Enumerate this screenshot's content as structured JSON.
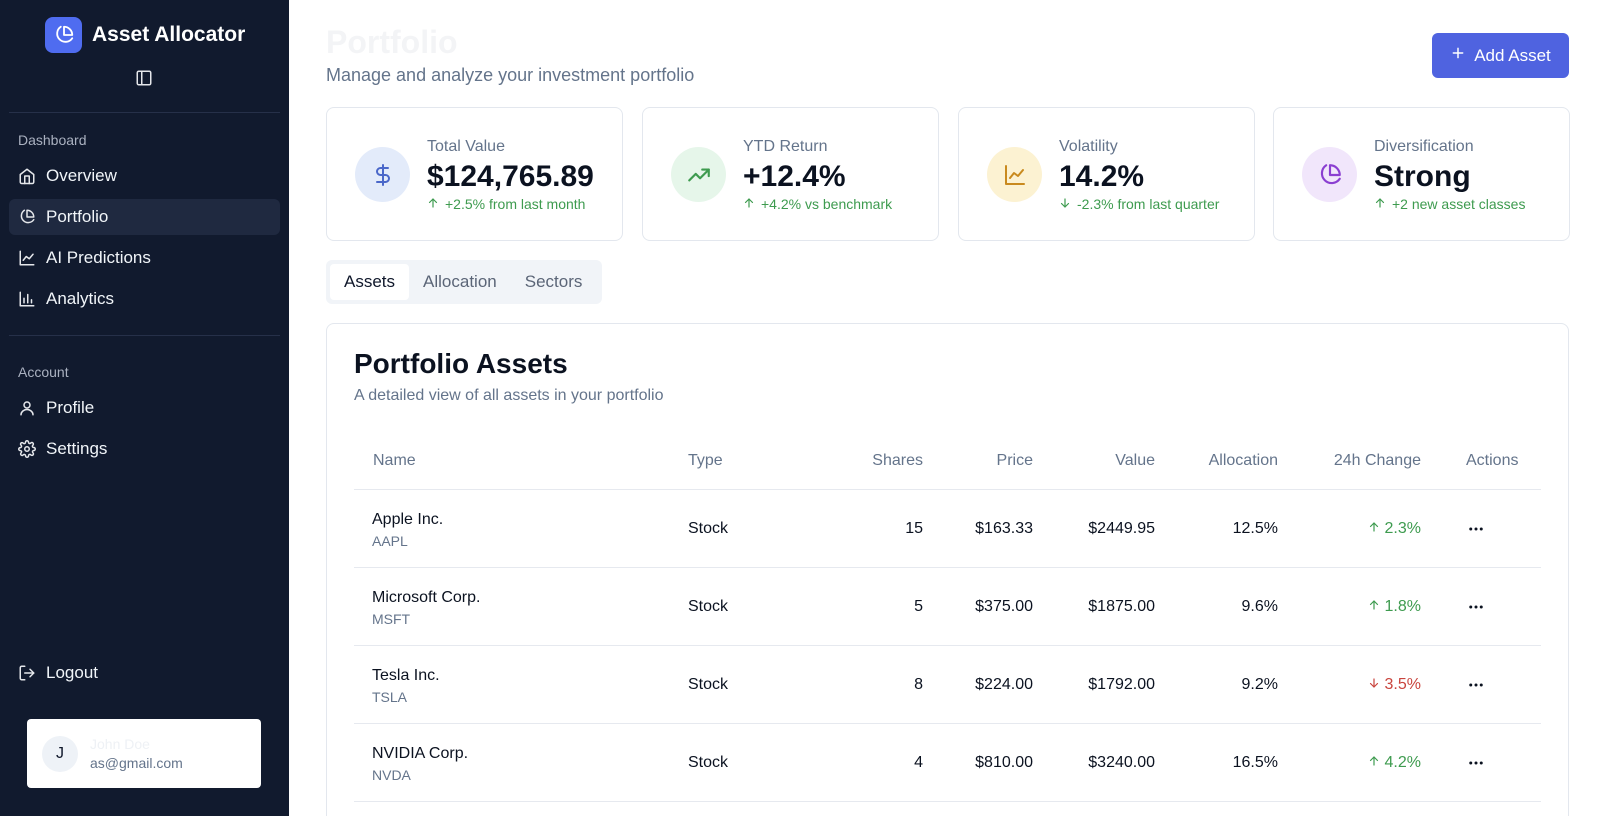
{
  "app": {
    "name": "Asset Allocator"
  },
  "sidebar": {
    "sections": [
      {
        "label": "Dashboard"
      },
      {
        "label": "Account"
      }
    ],
    "items": [
      {
        "label": "Overview",
        "icon": "home-icon"
      },
      {
        "label": "Portfolio",
        "icon": "pie-chart-icon",
        "active": true
      },
      {
        "label": "AI Predictions",
        "icon": "line-chart-icon"
      },
      {
        "label": "Analytics",
        "icon": "bar-chart-icon"
      },
      {
        "label": "Profile",
        "icon": "user-icon"
      },
      {
        "label": "Settings",
        "icon": "gear-icon"
      }
    ],
    "logout": {
      "label": "Logout",
      "icon": "logout-icon"
    },
    "user": {
      "initial": "J",
      "name": "John Doe",
      "email": "as@gmail.com"
    }
  },
  "header": {
    "title": "Portfolio",
    "subtitle": "Manage and analyze your investment portfolio",
    "add_button": "Add Asset"
  },
  "stats": [
    {
      "label": "Total Value",
      "value": "$124,765.89",
      "change": "+2.5% from last month",
      "direction": "up",
      "icon": "dollar-icon",
      "icon_color": "#4a67c9",
      "icon_bg": "#e3ebfa"
    },
    {
      "label": "YTD Return",
      "value": "+12.4%",
      "change": "+4.2% vs benchmark",
      "direction": "up",
      "icon": "trending-up-icon",
      "icon_color": "#3e9b4f",
      "icon_bg": "#e6f6ea"
    },
    {
      "label": "Volatility",
      "value": "14.2%",
      "change": "-2.3% from last quarter",
      "direction": "down",
      "icon": "line-chart-icon",
      "icon_color": "#c98a1e",
      "icon_bg": "#fcf2d2"
    },
    {
      "label": "Diversification",
      "value": "Strong",
      "change": "+2 new asset classes",
      "direction": "up",
      "icon": "pie-chart-icon",
      "icon_color": "#8b3fd1",
      "icon_bg": "#f1e6fb"
    }
  ],
  "tabs": [
    {
      "label": "Assets",
      "active": true
    },
    {
      "label": "Allocation"
    },
    {
      "label": "Sectors"
    }
  ],
  "assets_panel": {
    "title": "Portfolio Assets",
    "subtitle": "A detailed view of all assets in your portfolio",
    "columns": [
      "Name",
      "Type",
      "Shares",
      "Price",
      "Value",
      "Allocation",
      "24h Change",
      "Actions"
    ],
    "rows": [
      {
        "name": "Apple Inc.",
        "ticker": "AAPL",
        "type": "Stock",
        "shares": "15",
        "price": "$163.33",
        "value": "$2449.95",
        "allocation": "12.5%",
        "change": "2.3%",
        "direction": "up"
      },
      {
        "name": "Microsoft Corp.",
        "ticker": "MSFT",
        "type": "Stock",
        "shares": "5",
        "price": "$375.00",
        "value": "$1875.00",
        "allocation": "9.6%",
        "change": "1.8%",
        "direction": "up"
      },
      {
        "name": "Tesla Inc.",
        "ticker": "TSLA",
        "type": "Stock",
        "shares": "8",
        "price": "$224.00",
        "value": "$1792.00",
        "allocation": "9.2%",
        "change": "3.5%",
        "direction": "down"
      },
      {
        "name": "NVIDIA Corp.",
        "ticker": "NVDA",
        "type": "Stock",
        "shares": "4",
        "price": "$810.00",
        "value": "$3240.00",
        "allocation": "16.5%",
        "change": "4.2%",
        "direction": "up"
      }
    ]
  },
  "colors": {
    "sidebar_bg": "#111a2e",
    "accent": "#4f63e0",
    "positive": "#3e9b4f",
    "negative": "#c9443d"
  }
}
